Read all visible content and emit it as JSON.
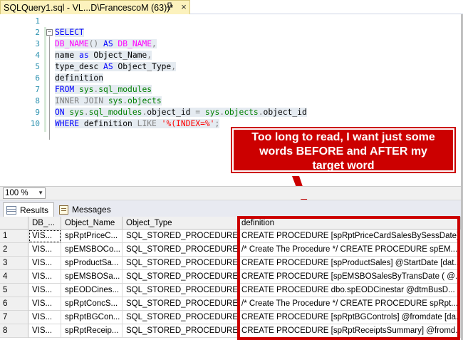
{
  "document_tab": {
    "title": "SQLQuery1.sql - VL...D\\FrancescoM (63))*",
    "pin_icon": "pin-icon",
    "close_icon": "close-icon",
    "accent": "#fcf2bd"
  },
  "editor": {
    "line_numbers": [
      "1",
      "2",
      "3",
      "4",
      "5",
      "6",
      "7",
      "8",
      "9",
      "10"
    ],
    "lines": [
      [],
      [
        {
          "t": "SELECT",
          "c": "kw"
        }
      ],
      [
        {
          "t": "DB_NAME",
          "c": "fn"
        },
        {
          "t": "() ",
          "c": "gray"
        },
        {
          "t": "AS ",
          "c": "kw"
        },
        {
          "t": "DB_NAME",
          "c": "fn"
        },
        {
          "t": ",",
          "c": "gray"
        }
      ],
      [
        {
          "t": "name ",
          "c": "blk"
        },
        {
          "t": "as ",
          "c": "kw"
        },
        {
          "t": "Object_Name",
          "c": "blk"
        },
        {
          "t": ",",
          "c": "gray"
        }
      ],
      [
        {
          "t": "type_desc ",
          "c": "blk"
        },
        {
          "t": "AS ",
          "c": "kw"
        },
        {
          "t": "Object_Type",
          "c": "blk"
        },
        {
          "t": ",",
          "c": "gray"
        }
      ],
      [
        {
          "t": "definition",
          "c": "blk"
        }
      ],
      [
        {
          "t": "FROM ",
          "c": "kw"
        },
        {
          "t": "sys",
          "c": "grn"
        },
        {
          "t": ".",
          "c": "gray"
        },
        {
          "t": "sql_modules",
          "c": "grn"
        }
      ],
      [
        {
          "t": "INNER JOIN ",
          "c": "gray"
        },
        {
          "t": "sys",
          "c": "grn"
        },
        {
          "t": ".",
          "c": "gray"
        },
        {
          "t": "objects",
          "c": "grn"
        }
      ],
      [
        {
          "t": "ON ",
          "c": "kw"
        },
        {
          "t": "sys",
          "c": "grn"
        },
        {
          "t": ".",
          "c": "gray"
        },
        {
          "t": "sql_modules",
          "c": "grn"
        },
        {
          "t": ".",
          "c": "gray"
        },
        {
          "t": "object_id ",
          "c": "blk"
        },
        {
          "t": "= ",
          "c": "gray"
        },
        {
          "t": "sys",
          "c": "grn"
        },
        {
          "t": ".",
          "c": "gray"
        },
        {
          "t": "objects",
          "c": "grn"
        },
        {
          "t": ".",
          "c": "gray"
        },
        {
          "t": "object_id",
          "c": "blk"
        }
      ],
      [
        {
          "t": "WHERE ",
          "c": "kw"
        },
        {
          "t": "definition ",
          "c": "blk"
        },
        {
          "t": "LIKE ",
          "c": "gray"
        },
        {
          "t": "'%(INDEX=%'",
          "c": "str"
        },
        {
          "t": ";",
          "c": "gray"
        }
      ]
    ]
  },
  "annotation": {
    "text_line1": "Too long to read, I want just some",
    "text_line2": "words BEFORE and AFTER my",
    "text_line3": "target word",
    "color": "#cc0000"
  },
  "zoom": {
    "value": "100 %"
  },
  "results_tabs": [
    {
      "label": "Results",
      "icon": "grid-icon",
      "active": true
    },
    {
      "label": "Messages",
      "icon": "messages-icon",
      "active": false
    }
  ],
  "grid": {
    "columns": [
      "DB_...",
      "Object_Name",
      "Object_Type",
      "definition"
    ],
    "rows": [
      [
        "1",
        "VIS...",
        "spRptPriceC...",
        "SQL_STORED_PROCEDURE",
        "CREATE PROCEDURE [spRptPriceCardSalesBySessDate] ..."
      ],
      [
        "2",
        "VIS...",
        "spEMSBOCo...",
        "SQL_STORED_PROCEDURE",
        "/* Create The Procedure */  CREATE PROCEDURE spEM..."
      ],
      [
        "3",
        "VIS...",
        "spProductSa...",
        "SQL_STORED_PROCEDURE",
        "CREATE PROCEDURE [spProductSales]   @StartDate [dat..."
      ],
      [
        "4",
        "VIS...",
        "spEMSBOSa...",
        "SQL_STORED_PROCEDURE",
        "CREATE PROCEDURE [spEMSBOSalesByTransDate (     @..."
      ],
      [
        "5",
        "VIS...",
        "spEODCines...",
        "SQL_STORED_PROCEDURE",
        "CREATE PROCEDURE dbo.spEODCinestar      @dtmBusD..."
      ],
      [
        "6",
        "VIS...",
        "spRptConcS...",
        "SQL_STORED_PROCEDURE",
        "/* Create The Procedure */  CREATE PROCEDURE spRpt..."
      ],
      [
        "7",
        "VIS...",
        "spRptBGCon...",
        "SQL_STORED_PROCEDURE",
        "CREATE PROCEDURE [spRptBGControls]   @fromdate [da..."
      ],
      [
        "8",
        "VIS...",
        "spRptReceip...",
        "SQL_STORED_PROCEDURE",
        "CREATE PROCEDURE [spRptReceiptsSummary]   @fromd..."
      ]
    ]
  }
}
